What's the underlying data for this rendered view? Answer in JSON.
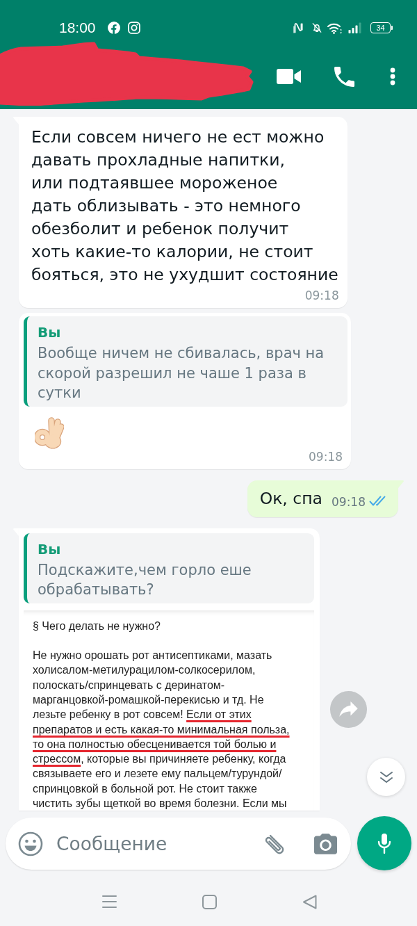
{
  "status_bar": {
    "time": "18:00",
    "battery": "34"
  },
  "messages": [
    {
      "outgoing": false,
      "tail": true,
      "body": {
        "kind": "text",
        "text": "Если совсем ничего не ест можно\nдавать прохладные напитки,\nили подтаявшее мороженое\nдать облизывать - это немного\nобезболит и ребенок получит\nхоть какие-то калории, не стоит\nбояться, это не ухудшит состояние"
      },
      "time": "09:18"
    },
    {
      "outgoing": false,
      "tail": false,
      "quote": {
        "author": "Вы",
        "text": "Вообще ничем не сбивалась, врач на скорой разрешил не чаше 1 раза в сутки"
      },
      "body": {
        "kind": "ok_hand"
      },
      "time": "09:18"
    },
    {
      "outgoing": true,
      "tail": true,
      "body": {
        "kind": "text",
        "text": "Ок, спа"
      },
      "time": "09:18",
      "read": true
    },
    {
      "outgoing": false,
      "tail": true,
      "quote": {
        "author": "Вы",
        "text": "Подскажите,чем горло еше обрабатывать?"
      },
      "body": {
        "kind": "document",
        "heading": "§ Чего делать не нужно?",
        "lines": [
          [
            {
              "text": "Не нужно орошать рот антисептиками, мазать",
              "underlined": false
            }
          ],
          [
            {
              "text": "холисалом-метилурацилом-солкосерилом,",
              "underlined": false
            }
          ],
          [
            {
              "text": "полоскать/спринцевать с деринатом-",
              "underlined": false
            }
          ],
          [
            {
              "text": "марганцовкой-ромашкой-перекисью и тд. Не",
              "underlined": false
            }
          ],
          [
            {
              "text": "лезьте ребенку в рот совсем! ",
              "underlined": false
            },
            {
              "text": "Если от этих",
              "underlined": true
            }
          ],
          [
            {
              "text": "препаратов и есть какая-то минимальная польза,",
              "underlined": true
            }
          ],
          [
            {
              "text": "то она полностью обесценивается той болью и",
              "underlined": true
            }
          ],
          [
            {
              "text": "стрессом",
              "underlined": true
            },
            {
              "text": ", которые вы причиняете ребенку, когда",
              "underlined": false
            }
          ],
          [
            {
              "text": "связываете его и лезете ему пальцем/турундой/",
              "underlined": false
            }
          ],
          [
            {
              "text": "спринцовкой в больной рот. Не стоит также",
              "underlined": false
            }
          ],
          [
            {
              "text": "чистить зубы щеткой во время болезни. Если мы",
              "underlined": false
            }
          ]
        ]
      }
    }
  ],
  "composer": {
    "placeholder": "Сообщение"
  }
}
